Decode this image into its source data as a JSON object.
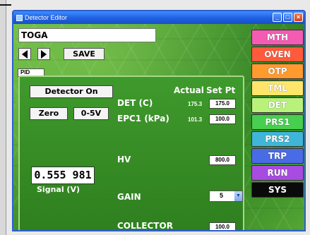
{
  "window": {
    "title": "Detector Editor"
  },
  "method_name": "TOGA",
  "toolbar": {
    "save_label": "SAVE"
  },
  "pid_label": "PID",
  "panel": {
    "detector_on_label": "Detector On",
    "zero_label": "Zero",
    "range_label": "0-5V",
    "header_actual": "Actual",
    "header_setpt": "Set Pt",
    "rows": {
      "det": {
        "label": "DET (C)",
        "actual": "175.3",
        "setpoint": "175.0"
      },
      "epc1": {
        "label": "EPC1 (kPa)",
        "actual": "101.3",
        "setpoint": "100.0"
      },
      "hv": {
        "label": "HV",
        "setpoint": "800.0"
      },
      "gain": {
        "label": "GAIN",
        "value": "5"
      },
      "collector": {
        "label": "COLLECTOR",
        "setpoint": "100.0"
      }
    },
    "signal": {
      "value": "0.555 981",
      "label": "Signal (V)"
    }
  },
  "side_menu": [
    {
      "label": "MTH",
      "color": "#f45bb2"
    },
    {
      "label": "OVEN",
      "color": "#ff5a3c"
    },
    {
      "label": "OTP",
      "color": "#ff9a2e"
    },
    {
      "label": "TML",
      "color": "#ffe66a"
    },
    {
      "label": "DET",
      "color": "#b9f27a"
    },
    {
      "label": "PRS1",
      "color": "#47cf4f"
    },
    {
      "label": "PRS2",
      "color": "#3fb6d8"
    },
    {
      "label": "TRP",
      "color": "#4a6be6"
    },
    {
      "label": "RUN",
      "color": "#a84be0"
    },
    {
      "label": "SYS",
      "color": "#0a0a0a"
    }
  ]
}
